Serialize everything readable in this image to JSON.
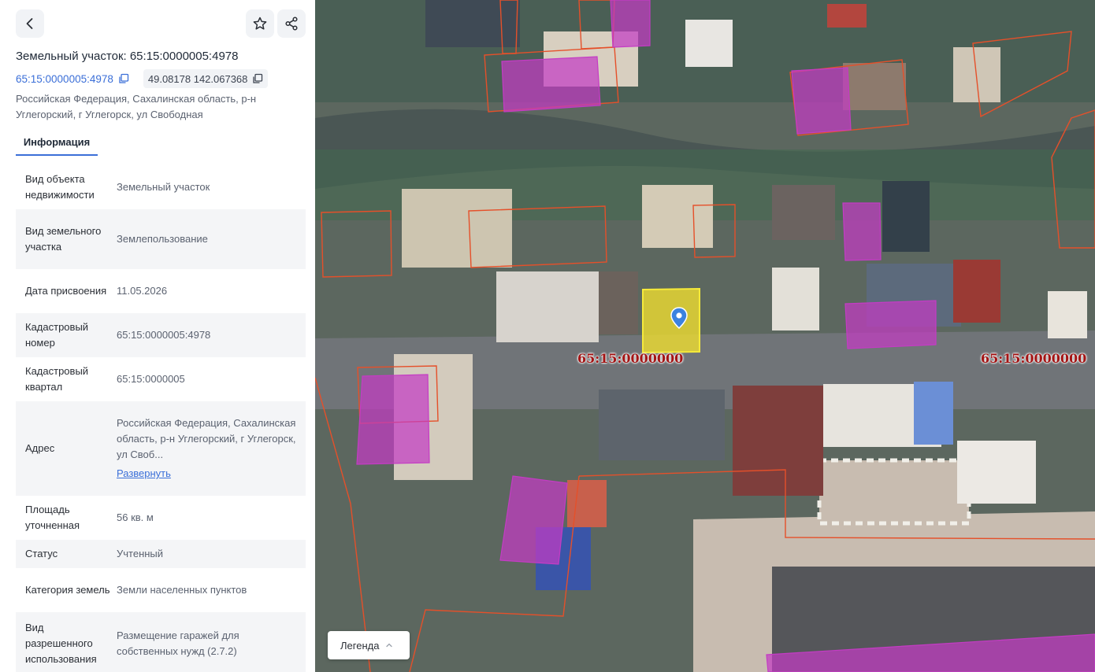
{
  "header": {
    "title": "Земельный участок: 65:15:0000005:4978",
    "cadastral_link": "65:15:0000005:4978",
    "coordinates": "49.08178 142.067368",
    "address": "Российская Федерация, Сахалинская область, р-н Углегорский, г Углегорск, ул Свободная"
  },
  "tabs": [
    {
      "label": "Информация",
      "active": true
    }
  ],
  "properties": [
    {
      "key": "Вид объекта недвижимости",
      "value": "Земельный участок"
    },
    {
      "key": "Вид земельного участка",
      "value": "Землепользование"
    },
    {
      "key": "Дата присвоения",
      "value": "11.05.2026"
    },
    {
      "key": "Кадастровый номер",
      "value": "65:15:0000005:4978"
    },
    {
      "key": "Кадастровый квартал",
      "value": "65:15:0000005"
    },
    {
      "key": "Адрес",
      "value": "Российская Федерация, Сахалинская область, р-н Углегорский, г Углегорск, ул Своб...",
      "action": "Развернуть"
    },
    {
      "key": "Площадь уточненная",
      "value": "56 кв. м"
    },
    {
      "key": "Статус",
      "value": "Учтенный"
    },
    {
      "key": "Категория земель",
      "value": "Земли населенных пунктов"
    },
    {
      "key": "Вид разрешенного использования",
      "value": "Размещение гаражей для собственных нужд (2.7.2)"
    }
  ],
  "map": {
    "labels": [
      "65:15:0000000",
      "65:15:0000000"
    ],
    "legend_button": "Легенда",
    "colors": {
      "parcel_outline": "#e5502a",
      "building_fill": "#c43cc4",
      "selected_fill": "#f2e02e",
      "label_text": "#a31414",
      "accent": "#3b6fd8"
    }
  }
}
